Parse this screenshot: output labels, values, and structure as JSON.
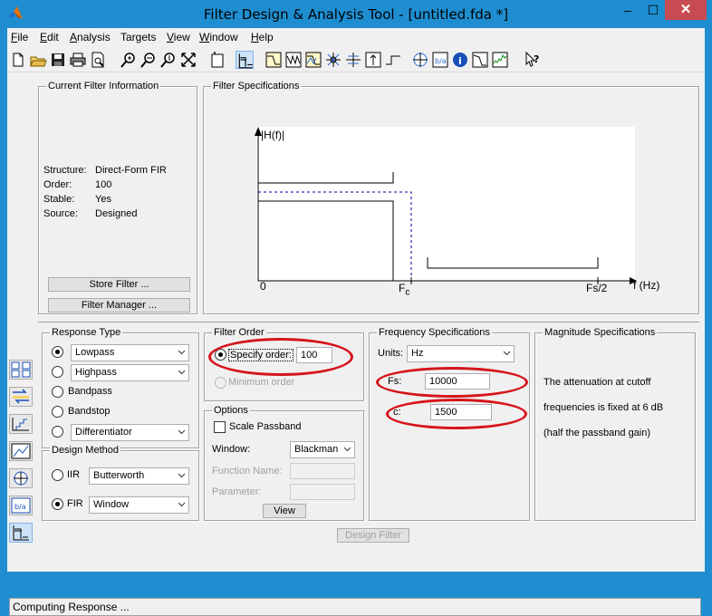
{
  "window": {
    "title": "Filter Design & Analysis Tool -  [untitled.fda *]",
    "minimize": "–",
    "maximize": "☐",
    "close": "✕"
  },
  "menu": [
    "File",
    "Edit",
    "Analysis",
    "Targets",
    "View",
    "Window",
    "Help"
  ],
  "menu_underline": [
    "F",
    "E",
    "A",
    "a",
    "V",
    "W",
    "H"
  ],
  "toolbar_icons": [
    "new-icon",
    "open-icon",
    "save-icon",
    "print-icon",
    "print-preview-icon",
    "zoom-in-icon",
    "zoom-x-icon",
    "zoom-y-icon",
    "full-view-icon",
    "new-window-icon",
    "filter-specs-icon",
    "magnitude-response-icon",
    "phase-response-icon",
    "magnitude-phase-icon",
    "group-delay-icon",
    "phase-delay-icon",
    "impulse-response-icon",
    "step-response-icon",
    "pole-zero-icon",
    "filter-coefficients-icon",
    "filter-info-icon",
    "magnitude-estimate-icon",
    "round-off-noise-icon",
    "whats-this-icon"
  ],
  "current_filter": {
    "title": "Current Filter Information",
    "rows": [
      {
        "label": "Structure:",
        "value": "Direct-Form FIR"
      },
      {
        "label": "Order:",
        "value": "100"
      },
      {
        "label": "Stable:",
        "value": "Yes"
      },
      {
        "label": "Source:",
        "value": "Designed"
      }
    ],
    "store_button": "Store Filter ...",
    "manager_button": "Filter Manager ..."
  },
  "filter_specs": {
    "title": "Filter Specifications",
    "y_label": "|H(f)|",
    "x_label": "f (Hz)",
    "zero_label": "0",
    "fc_label": "F",
    "fc_sub": "c",
    "fs2_label": "Fs/2"
  },
  "response_type": {
    "title": "Response Type",
    "options": [
      "Lowpass",
      "Highpass",
      "Bandpass",
      "Bandstop",
      "Differentiator"
    ],
    "selected": "Lowpass"
  },
  "design_method": {
    "title": "Design Method",
    "iir_label": "IIR",
    "iir_value": "Butterworth",
    "fir_label": "FIR",
    "fir_value": "Window",
    "selected": "FIR"
  },
  "filter_order": {
    "title": "Filter Order",
    "specify_label": "Specify order:",
    "specify_value": "100",
    "minimum_label": "Minimum order"
  },
  "options": {
    "title": "Options",
    "scale_passband": "Scale Passband",
    "window_label": "Window:",
    "window_value": "Blackman",
    "function_name_label": "Function Name:",
    "parameter_label": "Parameter:",
    "view_button": "View"
  },
  "frequency_specs": {
    "title": "Frequency Specifications",
    "units_label": "Units:",
    "units_value": "Hz",
    "fs_label": "Fs:",
    "fs_value": "10000",
    "fc_label": "c:",
    "fc_value": "1500"
  },
  "magnitude_specs": {
    "title": "Magnitude Specifications",
    "line1": "The attenuation at cutoff",
    "line2": "frequencies is fixed at 6 dB",
    "line3": "(half the passband gain)"
  },
  "design_button": "Design Filter",
  "status": "Computing Response ...",
  "colors": {
    "title_bg": "#1e8ed1",
    "close_bg": "#c74b50",
    "annotation": "#d6141b",
    "dashed": "#0000a0"
  }
}
